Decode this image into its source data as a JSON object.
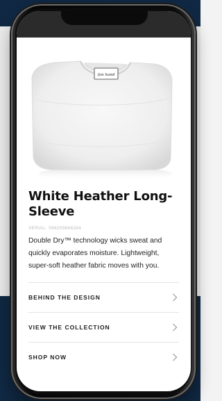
{
  "product": {
    "title": "White Heather Long-Sleeve",
    "serial": "SERIAL: 598259846284",
    "description": "Double Dry™ technology wicks sweat and quickly evaporates moisture. Lightweight, super-soft heather fabric moves with you.",
    "tag_text": "fan hand",
    "image_name": "folded-white-shirt"
  },
  "menu": {
    "items": [
      {
        "label": "BEHIND THE DESIGN",
        "icon": "chevron-right-icon"
      },
      {
        "label": "VIEW THE COLLECTION",
        "icon": "chevron-right-icon"
      },
      {
        "label": "SHOP NOW",
        "icon": "chevron-right-icon"
      }
    ]
  },
  "colors": {
    "background_navy": "#102843",
    "background_light": "#e9e9e9",
    "status_bar": "#2b2b2b",
    "text_primary": "#111111",
    "divider": "#e2e2e2"
  }
}
